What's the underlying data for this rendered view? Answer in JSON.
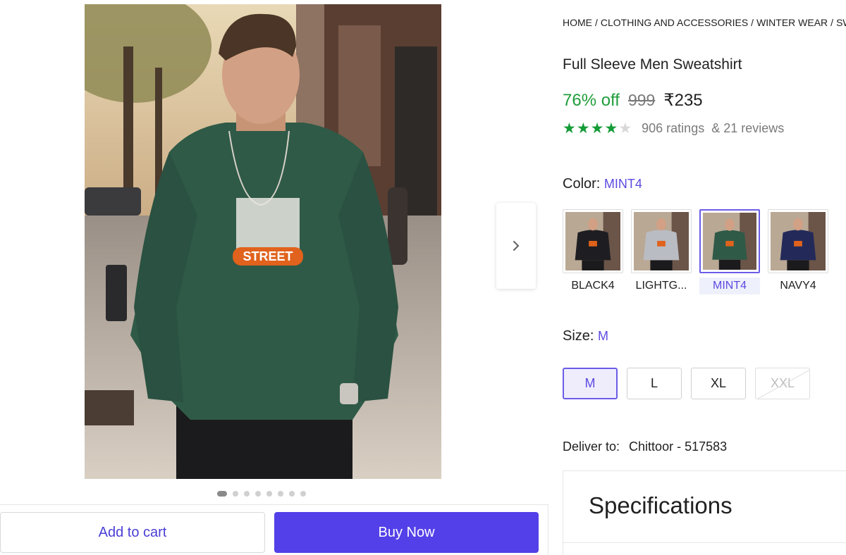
{
  "breadcrumb": {
    "items": [
      "HOME",
      "CLOTHING AND ACCESSORIES",
      "WINTER WEAR",
      "SW"
    ],
    "separator": "/"
  },
  "product": {
    "title": "Full Sleeve Men Sweatshirt",
    "discount": "76% off",
    "mrp": "999",
    "price": "₹235",
    "rating_stars": 4,
    "ratings_text": "906 ratings",
    "reviews_text": "& 21 reviews"
  },
  "gallery": {
    "image_count": 8,
    "active_index": 0,
    "next_icon": "chevron-right-icon"
  },
  "color": {
    "label": "Color:",
    "selected": "MINT4",
    "options": [
      {
        "name": "BLACK4",
        "color": "#1e1e22"
      },
      {
        "name": "LIGHTG...",
        "color": "#b9bcc2"
      },
      {
        "name": "MINT4",
        "color": "#2f5a47"
      },
      {
        "name": "NAVY4",
        "color": "#232a5a"
      }
    ]
  },
  "size": {
    "label": "Size:",
    "selected": "M",
    "options": [
      {
        "name": "M",
        "state": "selected"
      },
      {
        "name": "L",
        "state": "available"
      },
      {
        "name": "XL",
        "state": "available"
      },
      {
        "name": "XXL",
        "state": "unavailable"
      }
    ]
  },
  "delivery": {
    "label": "Deliver to:",
    "location": "Chittoor - 517583"
  },
  "specifications": {
    "title": "Specifications"
  },
  "actions": {
    "add_to_cart": "Add to cart",
    "buy_now": "Buy Now"
  },
  "theme": {
    "accent": "#5340e8",
    "discount_green": "#1f9d3a",
    "star_green": "#149c38",
    "sweatshirt": "#2f5a47"
  }
}
